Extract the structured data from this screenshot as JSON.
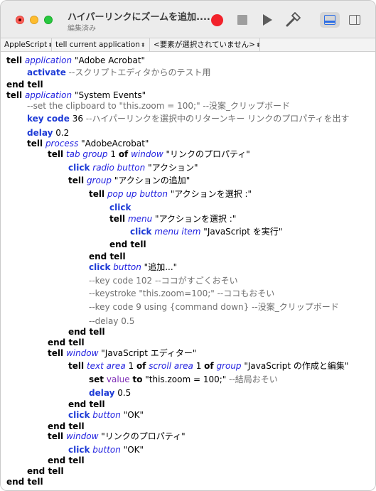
{
  "window": {
    "title": "ハイパーリンクにズームを追加....",
    "subtitle": "編集済み"
  },
  "toolbar": {
    "record": "record-button",
    "stop": "stop-button",
    "run": "run-button",
    "compile": "compile-button"
  },
  "navbar": {
    "language": "AppleScript",
    "target": "tell current application",
    "element": "<要素が選択されていません>",
    "arrows": "⬍"
  },
  "code": {
    "l1": [
      "tell",
      " ",
      "application",
      " \"Adobe Acrobat\""
    ],
    "l2": [
      "activate",
      " --スクリプトエディタからのテスト用"
    ],
    "l3": [
      "end tell"
    ],
    "l4": [
      "tell",
      " ",
      "application",
      " \"System Events\""
    ],
    "l5": [
      "--set the clipboard to \"this.zoom = 100;\" --没案_クリップボード"
    ],
    "l6": [
      "key code",
      " 36 ",
      "--ハイパーリンクを選択中のリターンキー リンクのプロパティを出す"
    ],
    "l7": [
      "delay",
      " 0.2"
    ],
    "l8": [
      "tell",
      " ",
      "process",
      " \"AdobeAcrobat\""
    ],
    "l9": [
      "tell",
      " ",
      "tab group",
      " 1 ",
      "of",
      " ",
      "window",
      " \"リンクのプロパティ\""
    ],
    "l10": [
      "click",
      " ",
      "radio button",
      " \"アクション\""
    ],
    "l11": [
      "tell",
      " ",
      "group",
      " \"アクションの追加\""
    ],
    "l12": [
      "tell",
      " ",
      "pop up button",
      " \"アクションを選択 :\""
    ],
    "l13": [
      "click"
    ],
    "l14": [
      "tell",
      " ",
      "menu",
      " \"アクションを選択 :\""
    ],
    "l15": [
      "click",
      " ",
      "menu item",
      " \"JavaScript を実行\""
    ],
    "l16": [
      "end tell"
    ],
    "l17": [
      "end tell"
    ],
    "l18": [
      "click",
      " ",
      "button",
      " \"追加...\""
    ],
    "l19": [
      "--key code 102 --ココがすごくおそい"
    ],
    "l20": [
      "--keystroke \"this.zoom=100;\" --ココもおそい"
    ],
    "l21": [
      "--key code 9 using {command down} --没案_クリップボード"
    ],
    "l22": [
      "--delay 0.5"
    ],
    "l23": [
      "end tell"
    ],
    "l24": [
      "end tell"
    ],
    "l25": [
      "tell",
      " ",
      "window",
      " \"JavaScript エディター\""
    ],
    "l26": [
      "tell",
      " ",
      "text area",
      " 1 ",
      "of",
      " ",
      "scroll area",
      " 1 ",
      "of",
      " ",
      "group",
      " \"JavaScript の作成と編集\""
    ],
    "l27": [
      "set",
      " ",
      "value",
      " ",
      "to",
      " \"this.zoom = 100;\" ",
      "--結局おそい"
    ],
    "l28": [
      "delay",
      " 0.5"
    ],
    "l29": [
      "end tell"
    ],
    "l30": [
      "click",
      " ",
      "button",
      " \"OK\""
    ],
    "l31": [
      "end tell"
    ],
    "l32": [
      "tell",
      " ",
      "window",
      " \"リンクのプロパティ\""
    ],
    "l33": [
      "click",
      " ",
      "button",
      " \"OK\""
    ],
    "l34": [
      "end tell"
    ],
    "l35": [
      "end tell"
    ],
    "l36": [
      "end tell"
    ]
  },
  "colors": {
    "keyword_blue": "#1e3bd6",
    "application_class": "#2222e0",
    "property_purple": "#7d2bb5",
    "comment_gray": "#6f6f6f",
    "record_red": "#f2222b"
  }
}
